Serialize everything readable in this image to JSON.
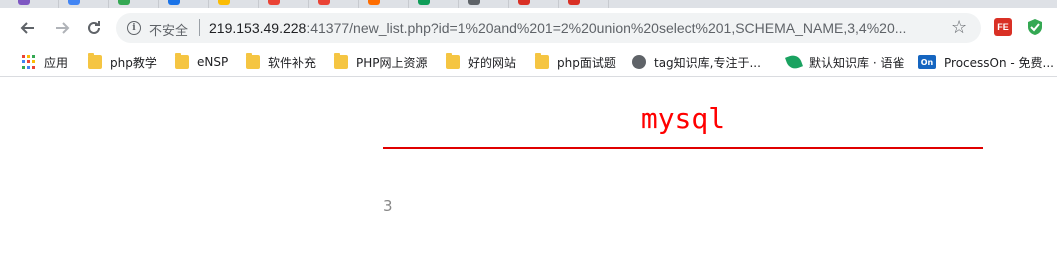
{
  "browser": {
    "security_label": "不安全",
    "url_host": "219.153.49.228",
    "url_rest": ":41377/new_list.php?id=1%20and%201=2%20union%20select%201,SCHEMA_NAME,3,4%20...",
    "ext_label": "FE",
    "tab_favicon_colors": [
      "#7e57c2",
      "#4285f4",
      "#34a853",
      "#1a73e8",
      "#fbbc04",
      "#ea4335",
      "#ea4335",
      "#ff6d00",
      "#0f9d58",
      "#5f6368",
      "#d93025",
      "#d93025"
    ]
  },
  "bookmarks": [
    {
      "label": "应用",
      "icon": "apps-icon"
    },
    {
      "label": "php教学",
      "icon": "folder-icon"
    },
    {
      "label": "eNSP",
      "icon": "folder-icon"
    },
    {
      "label": "软件补充",
      "icon": "folder-icon"
    },
    {
      "label": "PHP网上资源",
      "icon": "folder-icon"
    },
    {
      "label": "好的网站",
      "icon": "folder-icon"
    },
    {
      "label": "php面试题",
      "icon": "folder-icon"
    },
    {
      "label": "tag知识库,专注于...",
      "icon": "globe-icon"
    },
    {
      "label": "默认知识库 · 语雀",
      "icon": "yuque-icon"
    },
    {
      "label": "ProcessOn - 免费...",
      "icon": "processon-icon"
    }
  ],
  "processon_icon_text": "On",
  "page": {
    "title": "mysql",
    "value": "3"
  },
  "colors": {
    "title": "#ff0000",
    "rule": "#e00000",
    "value": "#888888"
  }
}
